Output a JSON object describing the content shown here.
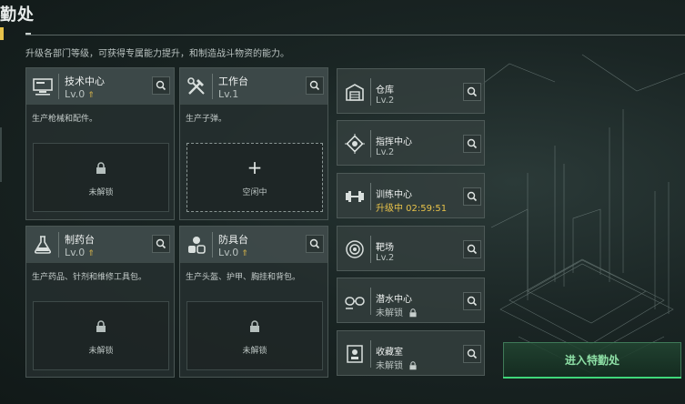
{
  "title": "勤处",
  "subtitle": "升级各部门等级，可获得专属能力提升，和制造战斗物资的能力。",
  "cards": [
    {
      "name": "技术中心",
      "level": "Lv.0",
      "upgradable": true,
      "desc": "生产枪械和配件。",
      "slot": "未解锁",
      "icon": "computer-icon"
    },
    {
      "name": "工作台",
      "level": "Lv.1",
      "upgradable": false,
      "desc": "生产子弹。",
      "slot": "空闲中",
      "icon": "tools-icon"
    },
    {
      "name": "制药台",
      "level": "Lv.0",
      "upgradable": true,
      "desc": "生产药品、针剂和维修工具包。",
      "slot": "未解锁",
      "icon": "flask-icon"
    },
    {
      "name": "防具台",
      "level": "Lv.0",
      "upgradable": true,
      "desc": "生产头盔、护甲、胸挂和背包。",
      "slot": "未解锁",
      "icon": "armor-icon"
    }
  ],
  "right_cards": [
    {
      "name": "仓库",
      "level": "Lv.2",
      "icon": "warehouse-icon"
    },
    {
      "name": "指挥中心",
      "level": "Lv.2",
      "icon": "command-icon"
    },
    {
      "name": "训练中心",
      "level": "升级中 02:59:51",
      "icon": "dumbbell-icon"
    },
    {
      "name": "靶场",
      "level": "Lv.2",
      "icon": "target-icon"
    },
    {
      "name": "潜水中心",
      "level": "未解锁",
      "icon": "goggles-icon"
    },
    {
      "name": "收藏室",
      "level": "未解锁",
      "icon": "collection-icon"
    }
  ],
  "enter_button": "进入特勤处",
  "colors": {
    "accent_gold": "#e7c24a",
    "accent_green": "#3fd77a"
  }
}
